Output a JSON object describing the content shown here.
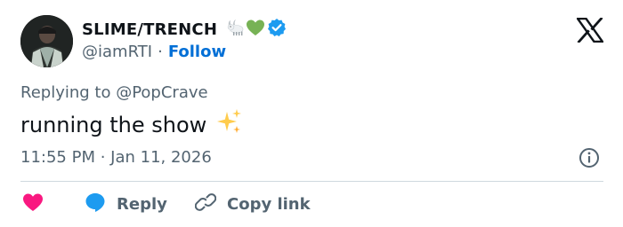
{
  "author": {
    "display_name": "SLIME/TRENCH",
    "handle": "@iamRTI",
    "separator": "·",
    "follow_label": "Follow",
    "badge_emojis": [
      "goat-emoji",
      "green-heart-emoji"
    ],
    "verified_icon": "verified-badge-icon"
  },
  "brand": {
    "logo_icon": "x-logo-icon"
  },
  "tweet": {
    "replying_to": "Replying to @PopCrave",
    "text": "running the show",
    "text_emoji": "sparkles-emoji",
    "timestamp": "11:55 PM · Jan 11, 2026",
    "info_icon": "info-icon"
  },
  "actions": {
    "like_icon": "heart-icon",
    "reply_label": "Reply",
    "reply_icon": "reply-bubble-icon",
    "copy_label": "Copy link",
    "copy_icon": "link-icon"
  },
  "colors": {
    "link_blue": "#006fd6",
    "secondary_text": "#536471",
    "heart_pink": "#f91880",
    "reply_blue": "#1d9bf0",
    "verified_blue": "#1d9bf0",
    "divider": "#cfd9de"
  }
}
